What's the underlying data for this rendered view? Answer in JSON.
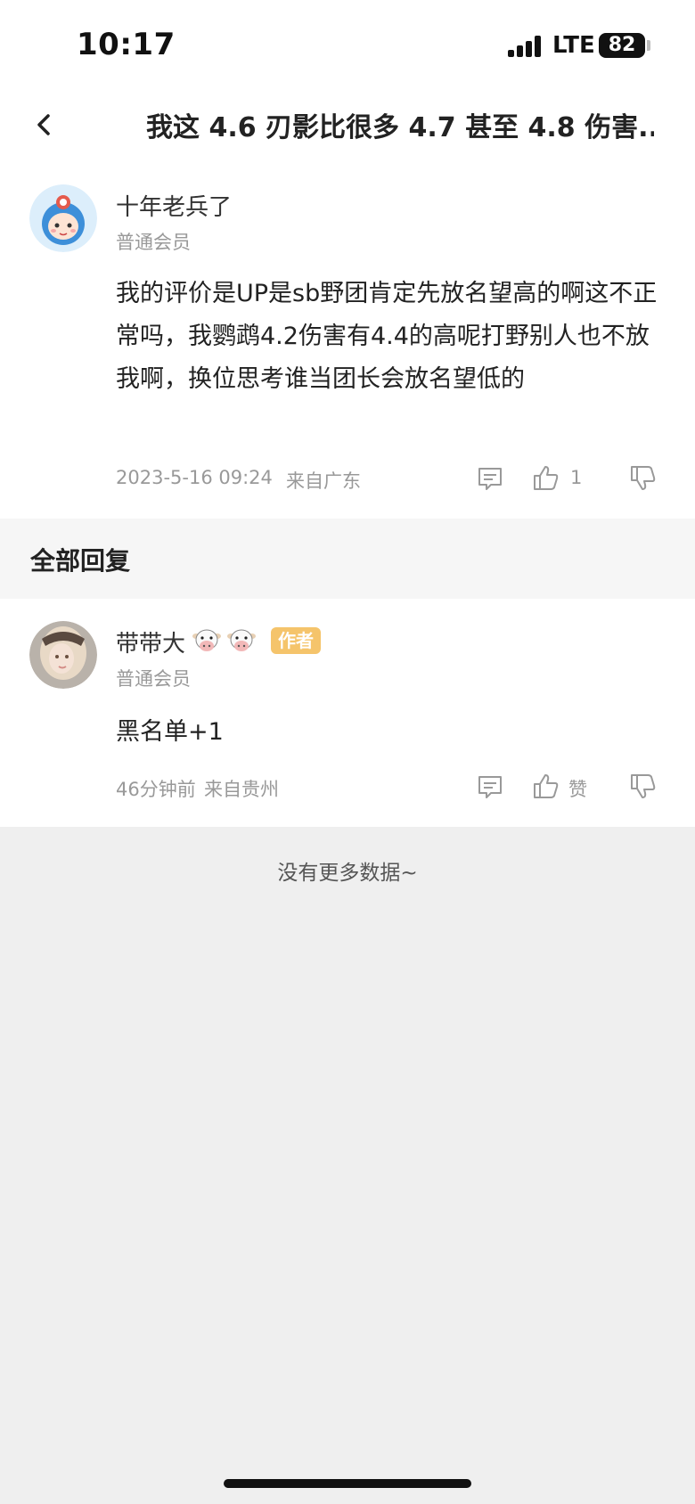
{
  "status_bar": {
    "time": "10:17",
    "network": "LTE",
    "battery": "82"
  },
  "nav": {
    "title": "我这 4.6 刃影比很多 4.7 甚至 4.8 伤害..."
  },
  "comment": {
    "username": "十年老兵了",
    "member_level": "普通会员",
    "body": "我的评价是UP是sb野团肯定先放名望高的啊这不正常吗，我鹦鹉4.2伤害有4.4的高呢打野别人也不放我啊，换位思考谁当团长会放名望低的",
    "timestamp": "2023-5-16 09:24",
    "location": "来自广东",
    "like_count": "1"
  },
  "replies_section": {
    "title": "全部回复"
  },
  "reply": {
    "username": "带带大",
    "badge": "作者",
    "member_level": "普通会员",
    "body": "黑名单+1",
    "timestamp": "46分钟前",
    "location": "来自贵州",
    "like_label": "赞"
  },
  "footer": {
    "no_more": "没有更多数据~"
  },
  "colors": {
    "badge": "#f5c46b",
    "background": "#efefef",
    "muted_text": "#999999"
  }
}
